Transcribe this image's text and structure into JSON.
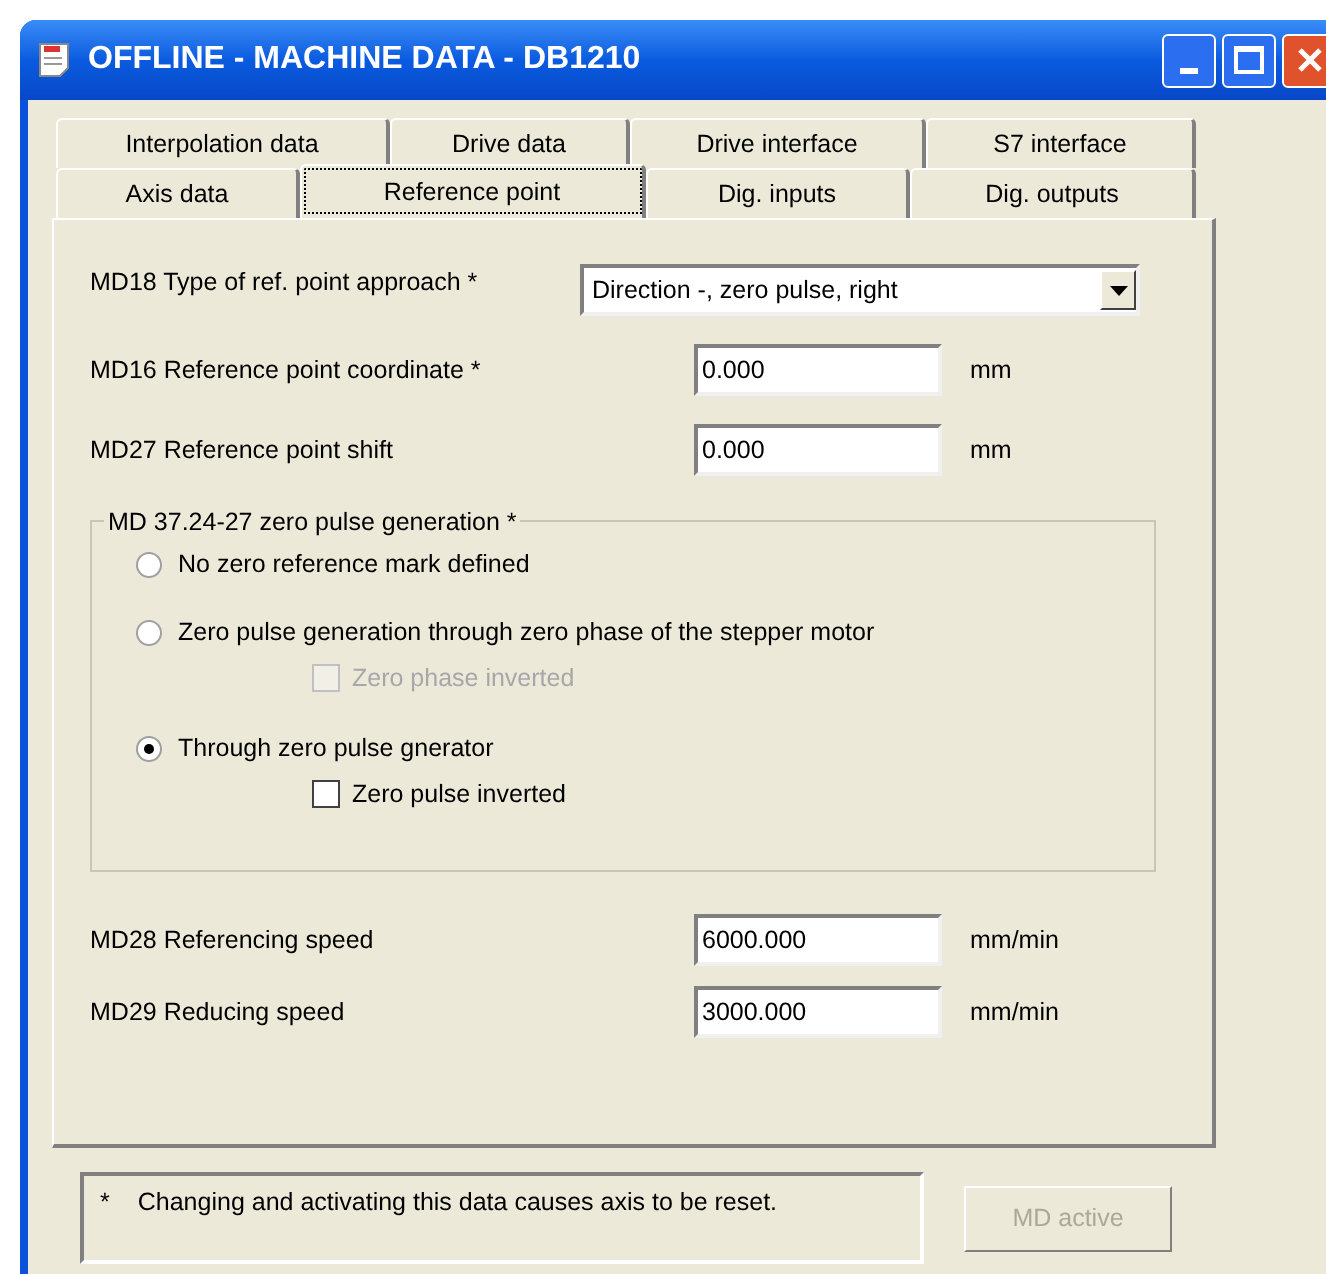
{
  "window": {
    "title": "OFFLINE - MACHINE DATA - DB1210"
  },
  "tab_rows": [
    [
      {
        "label": "Interpolation data",
        "selected": false
      },
      {
        "label": "Drive data",
        "selected": false
      },
      {
        "label": "Drive interface",
        "selected": false
      },
      {
        "label": "S7 interface",
        "selected": false
      }
    ],
    [
      {
        "label": "Axis data",
        "selected": false
      },
      {
        "label": "Reference point",
        "selected": true
      },
      {
        "label": "Dig. inputs",
        "selected": false
      },
      {
        "label": "Dig. outputs",
        "selected": false
      }
    ]
  ],
  "top_fields": [
    {
      "kind": "dropdown",
      "label": "MD18 Type of ref. point approach *",
      "value": "Direction -, zero pulse, right"
    },
    {
      "kind": "input",
      "label": "MD16 Reference point coordinate *",
      "value": "0.000",
      "unit": "mm"
    },
    {
      "kind": "input",
      "label": "MD27 Reference point shift",
      "value": "0.000",
      "unit": "mm"
    }
  ],
  "zero_pulse_group": {
    "title": "MD 37.24-27 zero pulse generation *",
    "options": [
      {
        "label": "No zero reference mark defined",
        "selected": false
      },
      {
        "label": "Zero pulse generation through zero phase of the stepper motor",
        "selected": false,
        "sub_checkbox": {
          "label": "Zero phase inverted",
          "checked": false,
          "disabled": true
        }
      },
      {
        "label": "Through zero pulse gnerator",
        "selected": true,
        "sub_checkbox": {
          "label": "Zero pulse inverted",
          "checked": false,
          "disabled": false
        }
      }
    ]
  },
  "speed_fields": [
    {
      "kind": "input",
      "label": "MD28 Referencing speed",
      "value": "6000.000",
      "unit": "mm/min"
    },
    {
      "kind": "input",
      "label": "MD29 Reducing speed",
      "value": "3000.000",
      "unit": "mm/min"
    }
  ],
  "footnote": {
    "marker": "*",
    "text": "Changing and activating this data causes axis to be reset."
  },
  "md_active_button": {
    "label": "MD active",
    "disabled": true
  }
}
